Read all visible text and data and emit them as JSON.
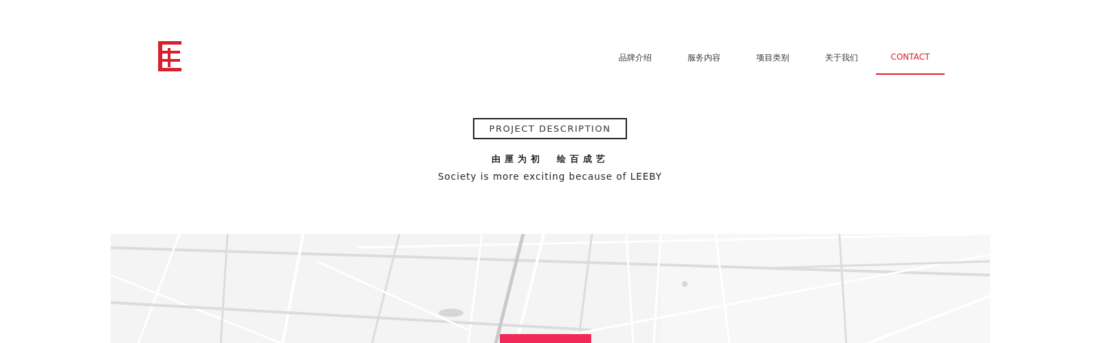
{
  "nav": [
    {
      "label": "品牌介绍",
      "selected": false
    },
    {
      "label": "服务内容",
      "selected": false
    },
    {
      "label": "项目类别",
      "selected": false
    },
    {
      "label": "关于我们",
      "selected": false
    },
    {
      "label": "CONTACT",
      "selected": true
    }
  ],
  "section": {
    "badge": "PROJECT DESCRIPTION",
    "slogan": "由厘为初　绘百成艺",
    "subtitle": "Society is more exciting because of LEEBY"
  }
}
